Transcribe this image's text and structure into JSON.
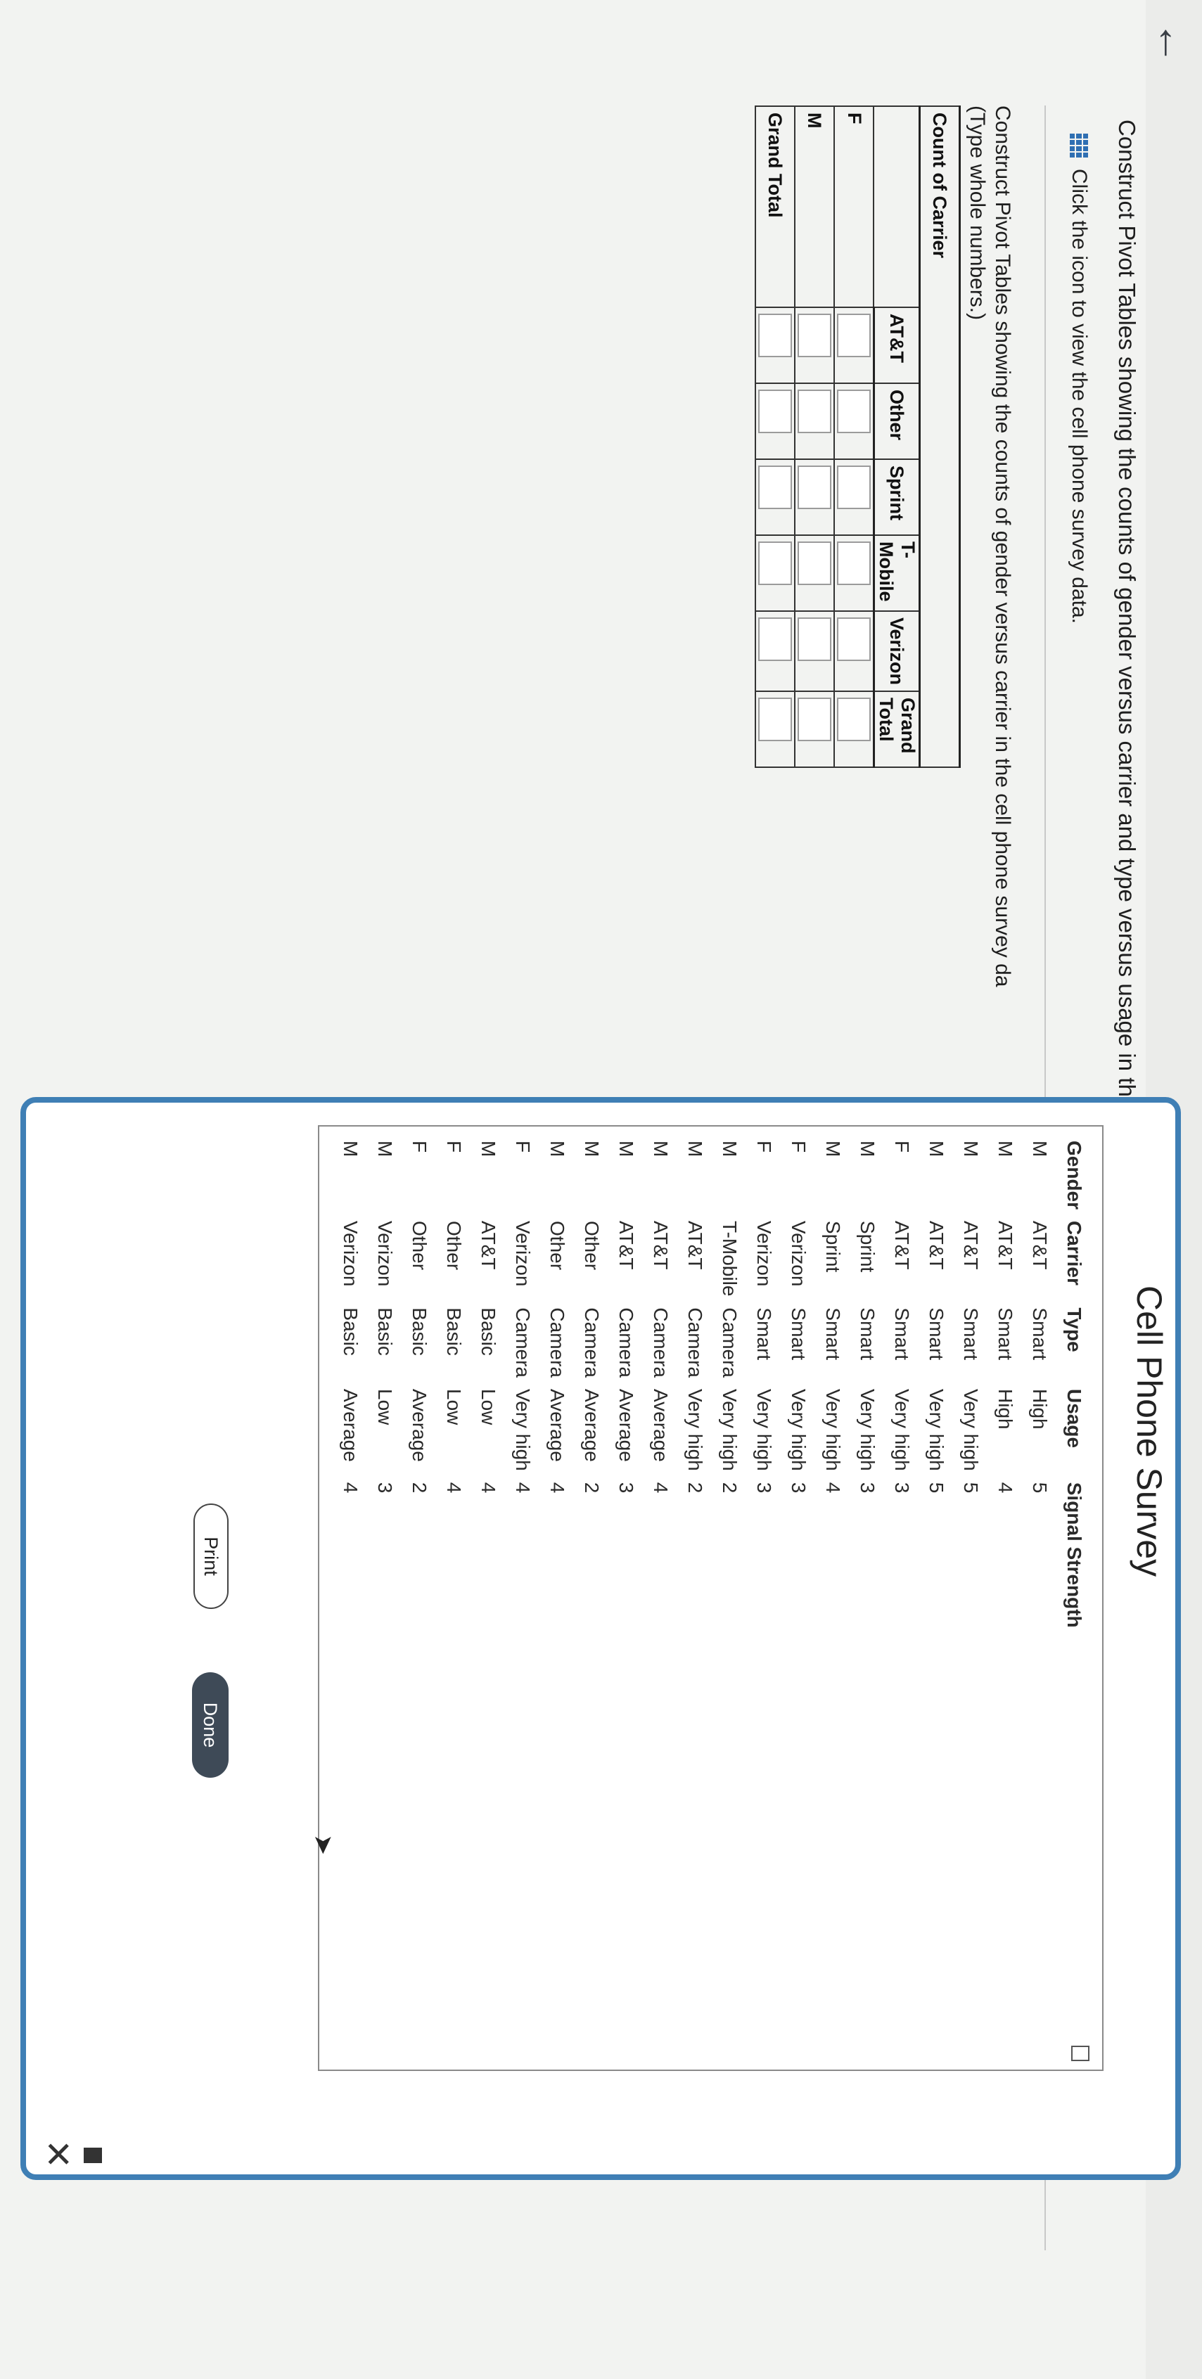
{
  "question": "Construct Pivot Tables showing the counts of gender versus carrier and type versus usage in the accompanying cell phone survey data. What could be concluded from this analysis?",
  "data_link": "Click the icon to view the cell phone survey data.",
  "instructions": {
    "line1": "Construct Pivot Tables showing the counts of gender versus carrier in the cell phone survey da",
    "line2": "(Type whole numbers.)"
  },
  "pivot": {
    "title": "Count of Carrier",
    "columns": [
      "AT&T",
      "Other",
      "Sprint",
      "T-Mobile",
      "Verizon",
      "Grand Total"
    ],
    "rows": [
      "F",
      "M",
      "Grand Total"
    ]
  },
  "modal": {
    "title": "Cell Phone Survey",
    "headers": [
      "Gender",
      "Carrier",
      "Type",
      "Usage",
      "Signal Strength"
    ],
    "rows": [
      [
        "M",
        "AT&T",
        "Smart",
        "High",
        "5"
      ],
      [
        "M",
        "AT&T",
        "Smart",
        "High",
        "4"
      ],
      [
        "M",
        "AT&T",
        "Smart",
        "Very high",
        "5"
      ],
      [
        "M",
        "AT&T",
        "Smart",
        "Very high",
        "5"
      ],
      [
        "F",
        "AT&T",
        "Smart",
        "Very high",
        "3"
      ],
      [
        "M",
        "Sprint",
        "Smart",
        "Very high",
        "3"
      ],
      [
        "M",
        "Sprint",
        "Smart",
        "Very high",
        "4"
      ],
      [
        "F",
        "Verizon",
        "Smart",
        "Very high",
        "3"
      ],
      [
        "F",
        "Verizon",
        "Smart",
        "Very high",
        "3"
      ],
      [
        "M",
        "T-Mobile",
        "Camera",
        "Very high",
        "2"
      ],
      [
        "M",
        "AT&T",
        "Camera",
        "Very high",
        "2"
      ],
      [
        "M",
        "AT&T",
        "Camera",
        "Average",
        "4"
      ],
      [
        "M",
        "AT&T",
        "Camera",
        "Average",
        "3"
      ],
      [
        "M",
        "Other",
        "Camera",
        "Average",
        "2"
      ],
      [
        "M",
        "Other",
        "Camera",
        "Average",
        "4"
      ],
      [
        "F",
        "Verizon",
        "Camera",
        "Very high",
        "4"
      ],
      [
        "M",
        "AT&T",
        "Basic",
        "Low",
        "4"
      ],
      [
        "F",
        "Other",
        "Basic",
        "Low",
        "4"
      ],
      [
        "F",
        "Other",
        "Basic",
        "Average",
        "2"
      ],
      [
        "M",
        "Verizon",
        "Basic",
        "Low",
        "3"
      ],
      [
        "M",
        "Verizon",
        "Basic",
        "Average",
        "4"
      ]
    ],
    "print_label": "Print",
    "done_label": "Done"
  },
  "icons": [
    "back-arrow-icon",
    "grid-data-icon",
    "minimize-icon",
    "close-icon",
    "copy-icon",
    "cursor-icon"
  ]
}
